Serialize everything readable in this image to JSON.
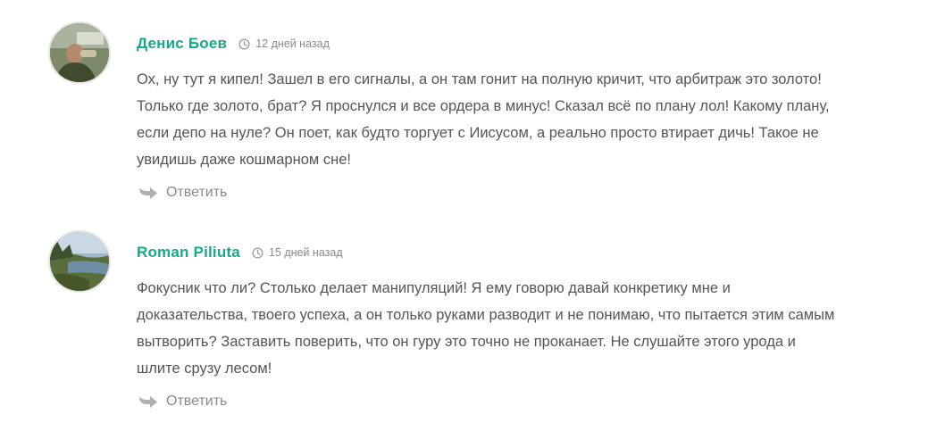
{
  "comments": [
    {
      "author": "Денис Боев",
      "date": "12 дней назад",
      "lines": [
        "Ох, ну тут я кипел! Зашел в его сигналы, а он там гонит на полную кричит, что арбитраж это золото!",
        "Только где золото, брат? Я проснулся и все ордера в минус! Сказал всё по плану лол! Какому плану,",
        "если депо на нуле? Он поет, как будто торгует с Иисусом, а реально просто втирает дичь! Такое не",
        "увидишь даже кошмарном сне!"
      ],
      "reply_label": "Ответить"
    },
    {
      "author": "Roman Piliuta",
      "date": "15 дней назад",
      "lines": [
        "Фокусник что ли? Столько делает манипуляций! Я ему говорю давай конкретику мне и",
        "доказательства, твоего успеха, а он только руками разводит и не понимаю, что пытается этим самым",
        "вытворить? Заставить поверить, что он гуру это точно не проканает. Не слушайте этого урода и",
        "шлите срузу лесом!"
      ],
      "reply_label": "Ответить"
    }
  ],
  "colors": {
    "author": "#18a88a",
    "meta": "#8a8a8a",
    "body_text": "#555555"
  },
  "icons": {
    "date": "clock-icon",
    "reply": "reply-arrow-icon"
  }
}
